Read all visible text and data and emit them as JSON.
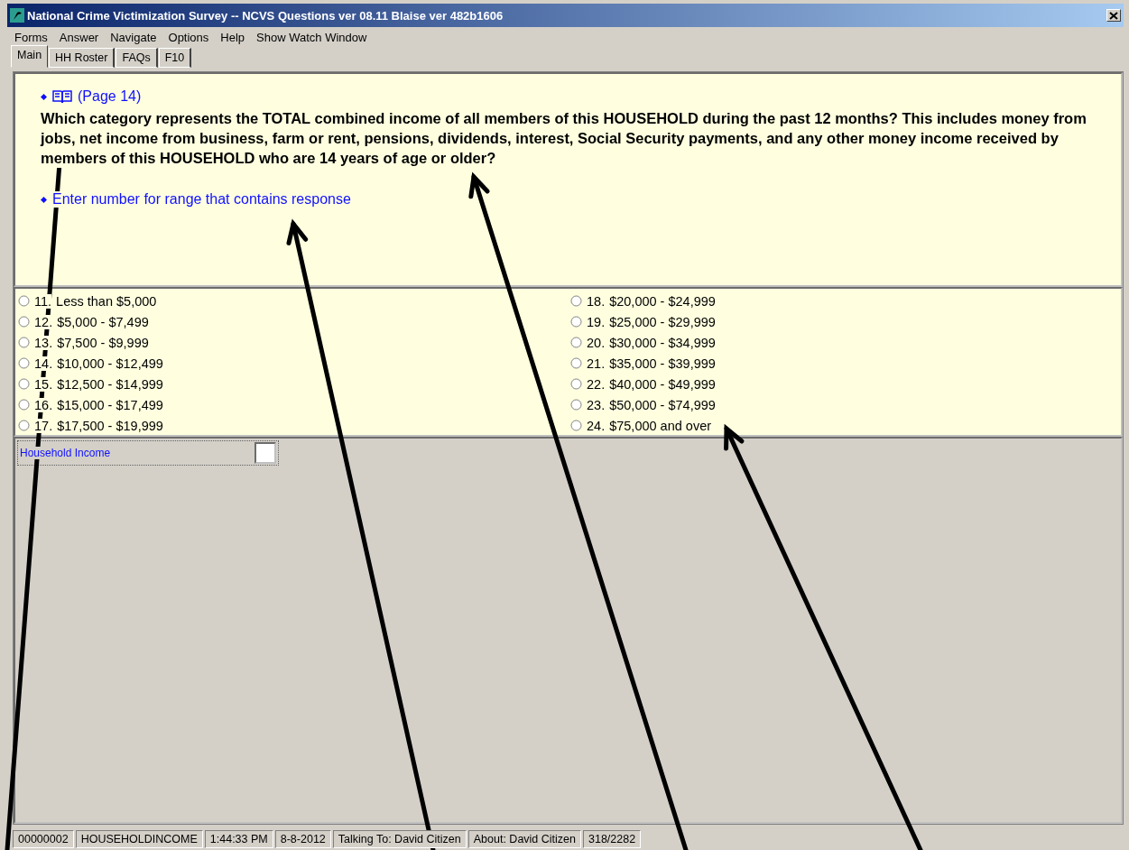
{
  "window": {
    "title": "National Crime Victimization Survey -- NCVS Questions ver 08.11 Blaise ver 482b1606"
  },
  "menu": [
    "Forms",
    "Answer",
    "Navigate",
    "Options",
    "Help",
    "Show Watch Window"
  ],
  "tabs": [
    {
      "label": "Main",
      "selected": true
    },
    {
      "label": "HH Roster",
      "selected": false
    },
    {
      "label": "FAQs",
      "selected": false
    },
    {
      "label": "F10",
      "selected": false
    }
  ],
  "question": {
    "page_ref": "(Page 14)",
    "text": "Which category represents the TOTAL combined income of all members of this HOUSEHOLD during the past 12 months? This includes money from jobs, net income from business, farm or rent, pensions, dividends, interest, Social Security payments, and any other money income received by members of this HOUSEHOLD who are 14 years of age or older?",
    "instruction": "Enter number for range that contains response"
  },
  "options": [
    {
      "number": "11.",
      "label": "Less than $5,000",
      "selected": false
    },
    {
      "number": "12.",
      "label": "$5,000 - $7,499",
      "selected": false
    },
    {
      "number": "13.",
      "label": "$7,500 - $9,999",
      "selected": false
    },
    {
      "number": "14.",
      "label": "$10,000 - $12,499",
      "selected": false
    },
    {
      "number": "15.",
      "label": "$12,500 - $14,999",
      "selected": false
    },
    {
      "number": "16.",
      "label": "$15,000 - $17,499",
      "selected": false
    },
    {
      "number": "17.",
      "label": "$17,500 - $19,999",
      "selected": false
    },
    {
      "number": "18.",
      "label": "$20,000 - $24,999",
      "selected": false
    },
    {
      "number": "19.",
      "label": "$25,000 - $29,999",
      "selected": false
    },
    {
      "number": "20.",
      "label": "$30,000 - $34,999",
      "selected": false
    },
    {
      "number": "21.",
      "label": "$35,000 - $39,999",
      "selected": false
    },
    {
      "number": "22.",
      "label": "$40,000 - $49,999",
      "selected": false
    },
    {
      "number": "23.",
      "label": "$50,000 - $74,999",
      "selected": false
    },
    {
      "number": "24.",
      "label": "$75,000 and over",
      "selected": false
    }
  ],
  "field": {
    "label": "Household Income"
  },
  "status_bar": [
    "00000002",
    "HOUSEHOLDINCOME",
    "1:44:33 PM",
    "8-8-2012",
    "Talking To: David Citizen",
    "About:  David Citizen",
    "318/2282"
  ]
}
